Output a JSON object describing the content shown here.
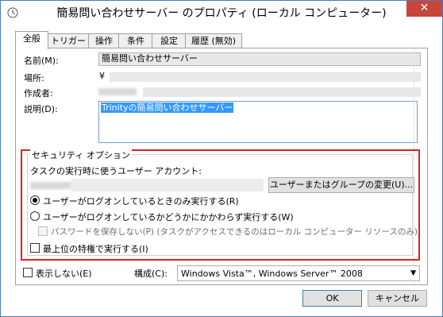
{
  "window": {
    "title": "簡易問い合わせサーバー のプロパティ (ローカル コンピューター)",
    "close_label": "✕"
  },
  "tabs": [
    {
      "label": "全般",
      "active": true
    },
    {
      "label": "トリガー"
    },
    {
      "label": "操作"
    },
    {
      "label": "条件"
    },
    {
      "label": "設定"
    },
    {
      "label": "履歴 (無効)"
    }
  ],
  "general": {
    "name_label": "名前(M):",
    "name_value": "簡易問い合わせサーバー",
    "location_label": "場所:",
    "location_value": "¥",
    "author_label": "作成者:",
    "description_label": "説明(D):",
    "description_value": "Trinityの簡易問い合わせサーバー"
  },
  "security": {
    "legend": "セキュリティ オプション",
    "account_label": "タスクの実行時に使うユーザー アカウント:",
    "change_button": "ユーザーまたはグループの変更(U)...",
    "radio_logged_on": "ユーザーがログオンしているときのみ実行する(R)",
    "radio_always": "ユーザーがログオンしているかどうかにかかわらず実行する(W)",
    "no_store_password": "パスワードを保存しない(P) (タスクがアクセスできるのはローカル コンピューター リソースのみ)",
    "highest_privileges": "最上位の特権で実行する(I)",
    "selected_option": "logged_on"
  },
  "bottom": {
    "hidden_label": "表示しない(E)",
    "configure_label": "構成(C):",
    "configure_value": "Windows Vista™, Windows Server™ 2008",
    "ok_label": "OK",
    "cancel_label": "キャンセル"
  },
  "colors": {
    "highlight_border": "#e02020",
    "selection": "#3399ff",
    "close_button": "#c7463a"
  }
}
